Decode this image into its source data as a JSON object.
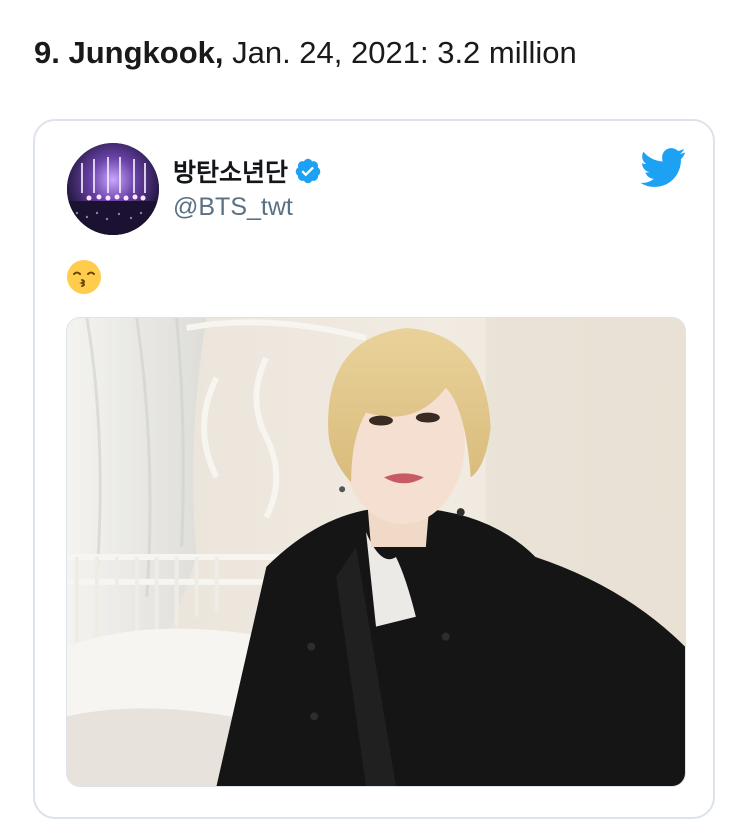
{
  "headline": {
    "rank_name": "9. Jungkook,",
    "date_count": " Jan. 24, 2021: 3.2 million"
  },
  "tweet": {
    "display_name": "방탄소년단",
    "handle": "@BTS_twt",
    "verified_icon": "verified-badge-icon",
    "platform_icon": "twitter-bird-icon",
    "body_emoji": "kissing-face-with-smiling-eyes-emoji",
    "media": "photo-blonde-man-black-jacket-selfie"
  },
  "colors": {
    "twitter_blue": "#1da1f2",
    "handle_gray": "#5b7083",
    "card_border": "#dde3ea"
  }
}
